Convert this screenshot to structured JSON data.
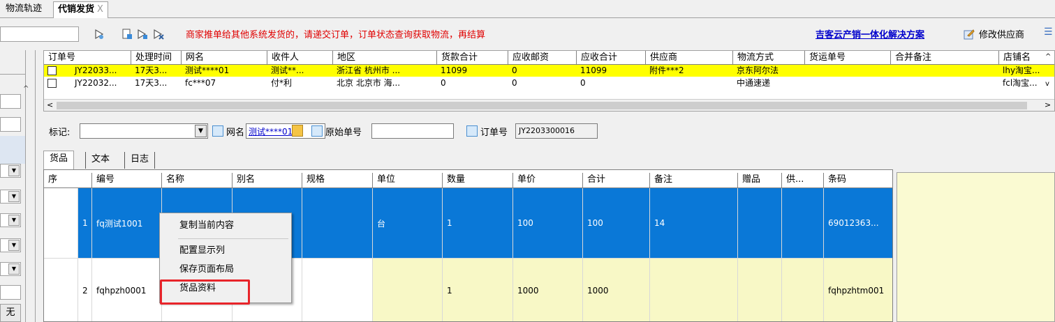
{
  "tabs": [
    {
      "label": "物流轨迹"
    },
    {
      "label": "代销发货",
      "close": "X"
    }
  ],
  "toolbar": {
    "search_value": "",
    "notice": "商家推单给其他系统发货的，请递交订单，订单状态查询获取物流，再结算",
    "promo_link": "吉客云产销一体化解决方案",
    "modify_supplier": "修改供应商",
    "menu_glyph": "☰"
  },
  "orders": {
    "columns": [
      "订单号",
      "处理时间",
      "网名",
      "收件人",
      "地区",
      "货款合计",
      "应收邮资",
      "应收合计",
      "供应商",
      "物流方式",
      "货运单号",
      "合并备注",
      "店铺名"
    ],
    "rows": [
      {
        "order_no": "JY22033...",
        "time": "17天3...",
        "nick": "测试****01",
        "receiver": "测试**...",
        "region": "浙江省 杭州市 ...",
        "goods_total": "11099",
        "postage": "0",
        "total": "11099",
        "supplier": "附件***2",
        "logistics": "京东阿尔法",
        "waybill": "",
        "merge_note": "",
        "shop": "lhy淘宝..."
      },
      {
        "order_no": "JY22032...",
        "time": "17天3...",
        "nick": "fc***07",
        "receiver": "付*利",
        "region": "北京 北京市 海...",
        "goods_total": "0",
        "postage": "0",
        "total": "0",
        "supplier": "",
        "logistics": "中通速递",
        "waybill": "",
        "merge_note": "",
        "shop": "fcl淘宝..."
      }
    ]
  },
  "markbar": {
    "mark_label": "标记:",
    "mark_value": "",
    "nick_label": "网名",
    "nick_value": "测试****01",
    "orig_label": "原始单号",
    "orig_value": "",
    "order_label": "订单号",
    "order_value": "JY2203300016"
  },
  "subtabs": [
    "货品",
    "文本",
    "日志"
  ],
  "goods": {
    "columns": [
      "序",
      "编号",
      "名称",
      "别名",
      "规格",
      "单位",
      "数量",
      "单价",
      "合计",
      "备注",
      "赠品",
      "供...",
      "条码"
    ],
    "rows": [
      {
        "seq": "1",
        "code": "fq测试1001",
        "name": "",
        "alias": "",
        "spec": "",
        "unit": "台",
        "qty": "1",
        "price": "100",
        "sum": "100",
        "note": "14",
        "gift": "",
        "sup": "",
        "barcode": "69012363..."
      },
      {
        "seq": "2",
        "code": "fqhpzh0001",
        "name": "",
        "alias": "",
        "spec": "",
        "unit": "",
        "qty": "1",
        "price": "1000",
        "sum": "1000",
        "note": "",
        "gift": "",
        "sup": "",
        "barcode": "fqhpzhtm001"
      }
    ]
  },
  "context_menu": {
    "items": [
      "复制当前内容",
      "配置显示列",
      "保存页面布局",
      "货品资料"
    ]
  },
  "left_panel": {
    "bottom_label": "无"
  },
  "colors": {
    "selected_row": "#0a78d7",
    "highlight_row": "#ffff00",
    "notice_text": "#e00000",
    "link": "#0000cc",
    "annotation_box": "#e8242a",
    "cream_cells": "#f8f8c6"
  }
}
